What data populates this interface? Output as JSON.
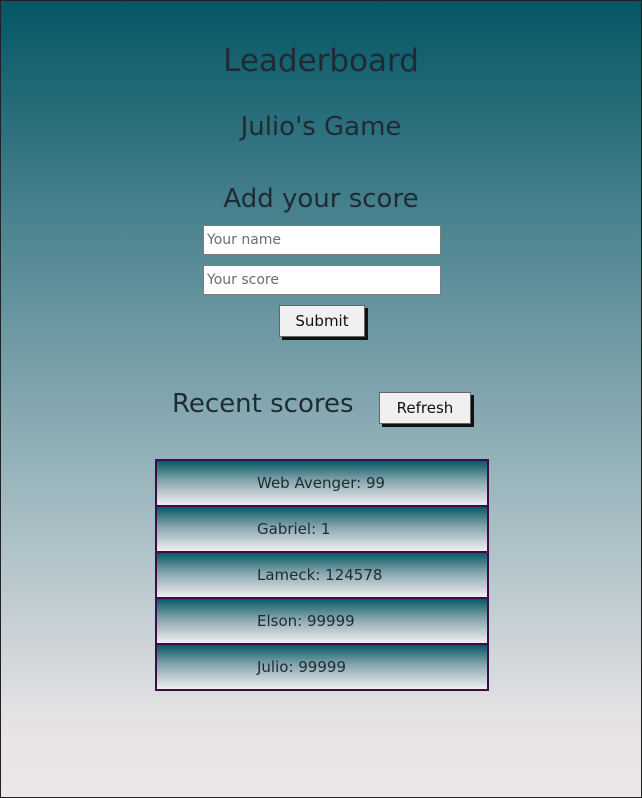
{
  "header": {
    "title": "Leaderboard",
    "subtitle": "Julio's Game"
  },
  "form": {
    "title": "Add your score",
    "name_placeholder": "Your name",
    "score_placeholder": "Your score",
    "submit_label": "Submit"
  },
  "recent": {
    "title": "Recent scores",
    "refresh_label": "Refresh",
    "scores": [
      "Web Avenger: 99",
      "Gabriel: 1",
      "Lameck: 124578",
      "Elson: 99999",
      "Julio: 99999"
    ]
  },
  "colors": {
    "background_top": "#045665",
    "background_bottom": "#ece8ea",
    "list_border": "#3d0b47"
  }
}
